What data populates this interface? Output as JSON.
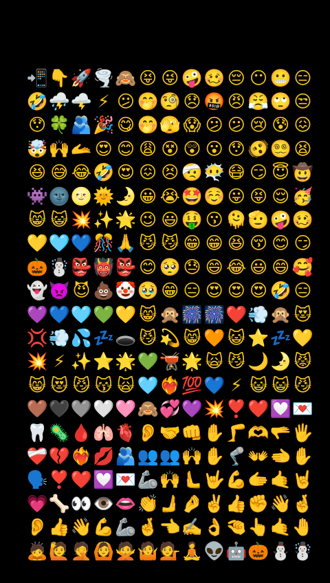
{
  "emoji_grid": {
    "rows": [
      [
        "📲",
        "👇",
        "🚀",
        "🌪️",
        "🙈",
        "😝",
        "😜",
        "🤪",
        "🥴",
        "😔",
        "😶",
        "😬",
        "😑"
      ],
      [
        "🤣",
        "⛈️",
        "🌩️",
        "⚡",
        "😕",
        "🤭",
        "🧐",
        "😞",
        "🤬",
        "😠",
        "😤",
        "🙄",
        "😒"
      ],
      [
        "😯",
        "🍀",
        "🫂",
        "🎉",
        "😋",
        "🤭",
        "🫣",
        "😱",
        "😕",
        "😕",
        "😢",
        "😰",
        "😖"
      ],
      [
        "🤯",
        "🙌",
        "🫴",
        "😍",
        "😊",
        "😩",
        "😵",
        "😲",
        "😮",
        "😯",
        "🫨",
        "😵‍💫",
        "😫"
      ],
      [
        "😆",
        "😅",
        "😂",
        "🤣",
        "😍",
        "😖",
        "😣",
        "🤕",
        "😶‍🌫️",
        "😷",
        "😏",
        "😇",
        "🤠"
      ],
      [
        "👾",
        "🌚",
        "🌝",
        "🌞",
        "🌛",
        "😀",
        "😭",
        "🤩",
        "☺️",
        "😛",
        "😝",
        "😌",
        "🥳"
      ],
      [
        "😸",
        "😺",
        "💥",
        "✨",
        "🌟",
        "😉",
        "😃",
        "🤑",
        "😗",
        "🫠",
        "🫡",
        "🤪",
        "🥴"
      ],
      [
        "💛",
        "🩵",
        "💙",
        "🎊",
        "🙏",
        "😼",
        "😼",
        "😁",
        "😁",
        "😆",
        "😚",
        "😊",
        "😏"
      ],
      [
        "🎃",
        "☃️",
        "👺",
        "👹",
        "👺",
        "😊",
        "🥺",
        "😓",
        "😄",
        "😂",
        "😃",
        "😄",
        "🥰"
      ],
      [
        "👻",
        "👿",
        "😈",
        "💩",
        "🤡",
        "🥹",
        "😁",
        "😑",
        "😍",
        "😍",
        "😍",
        "🤣",
        "😑"
      ],
      [
        "💜",
        "💙",
        "🩵",
        "💚",
        "💛",
        "😸",
        "🙊",
        "🎆",
        "🎆",
        "❤️",
        "💨",
        "🙊",
        "😻"
      ],
      [
        "💢",
        "💨",
        "💦",
        "💤",
        "🕳️",
        "😼",
        "💫",
        "😸",
        "🧡",
        "😺",
        "⭐",
        "💤",
        "💛"
      ],
      [
        "💥",
        "⚡",
        "✨",
        "⭐",
        "🌟",
        "💚",
        "🫕",
        "🌟",
        "🙀",
        "😼",
        "🌙",
        "🌛",
        "😾"
      ],
      [
        "😸",
        "😻",
        "😼",
        "😽",
        "🙀",
        "🩵",
        "❤️‍🔥",
        "💯",
        "💙",
        "⚡",
        "😺",
        "😺",
        "😼"
      ],
      [
        "🤎",
        "🖤",
        "🩶",
        "🤍",
        "🩷",
        "🙈",
        "💞",
        "💜",
        "💥",
        "❣️",
        "❤️",
        "💟",
        "💌"
      ],
      [
        "🦷",
        "🦠",
        "🩸",
        "🫁",
        "🫀",
        "👂",
        "🤝",
        "👊",
        "✋",
        "🦵",
        "🫶",
        "🫳",
        "🖐️"
      ],
      [
        "❤️‍🩹",
        "💔",
        "❤️‍🔥",
        "💋",
        "🫂",
        "👥",
        "👥",
        "🙌",
        "✋",
        "🦿",
        "👐",
        "🫲",
        "✋"
      ],
      [
        "🗣️",
        "❣️",
        "❤️",
        "💟",
        "💌",
        "🦾",
        "🙌",
        "🫷",
        "🤟",
        "💪",
        "🫱",
        "🤙",
        "🤘"
      ],
      [
        "💗",
        "🦴",
        "👀",
        "👁️",
        "👄",
        "👏",
        "🫸",
        "🤌",
        "✌️",
        "👍",
        "✊",
        "👋",
        "🤞"
      ],
      [
        "👂",
        "👍",
        "👋",
        "💪",
        "🦾",
        "🤞",
        "👈",
        "✍️",
        "👌",
        "🤏",
        "👆",
        "🤙",
        "🤚"
      ],
      [
        "🙇",
        "🙋",
        "🤦",
        "🙆",
        "🙅",
        "🤷",
        "💁",
        "🧘",
        "👽",
        "🤖",
        "🎃",
        "⛄",
        "☃️"
      ]
    ]
  }
}
